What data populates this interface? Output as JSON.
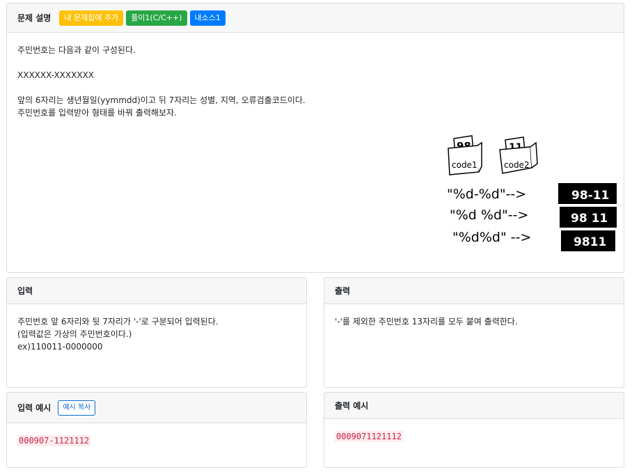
{
  "problem": {
    "title": "문제 설명",
    "badges": [
      "내 문제집에 추가",
      "풀이1(C/C++)",
      "내소스1"
    ],
    "lines": [
      "주민번호는 다음과 같이 구성된다.",
      "",
      "XXXXXX-XXXXXXX",
      "",
      "앞의 6자리는 생년월일(yymmdd)이고 뒤 7자리는 성별, 지역, 오류검출코드이다.",
      "주민번호를 입력받아 형태를 바꿔 출력해보자."
    ],
    "illustration": {
      "box1_num": "98",
      "box1_label": "code1",
      "box2_num": "11",
      "box2_label": "code2",
      "rows": [
        {
          "format": "\"%d-%d\"-->",
          "result": "98-11"
        },
        {
          "format": "\"%d %d\"-->",
          "result": "98 11"
        },
        {
          "format": "\"%d%d\" -->",
          "result": "9811"
        }
      ]
    }
  },
  "input": {
    "title": "입력",
    "lines": [
      "주민번호 앞 6자리와 뒷 7자리가 '-'로 구분되어 입력된다.",
      "(입력값은 가상의 주민번호이다.)",
      "ex)110011-0000000"
    ]
  },
  "output": {
    "title": "출력",
    "lines": [
      "'-'를 제외한 주민번호 13자리를 모두 붙여 출력한다."
    ]
  },
  "sample_input": {
    "title": "입력 예시",
    "copy_label": "예시 복사",
    "value": "000907-1121112"
  },
  "sample_output": {
    "title": "출력 예시",
    "value": "0009071121112"
  }
}
